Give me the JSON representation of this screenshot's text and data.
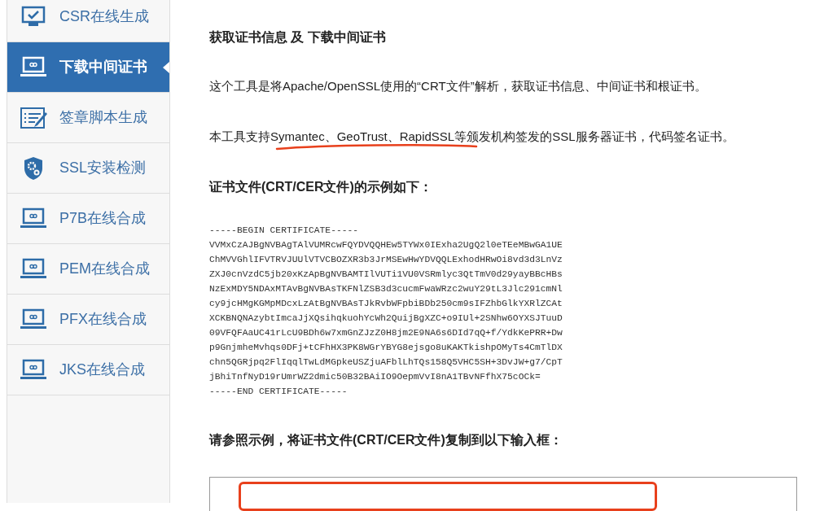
{
  "sidebar": {
    "items": [
      {
        "label": "CSR在线生成",
        "kind": "monitor",
        "selected": false
      },
      {
        "label": "下载中间证书",
        "kind": "laptop",
        "selected": true
      },
      {
        "label": "签章脚本生成",
        "kind": "form",
        "selected": false
      },
      {
        "label": "SSL安装检测",
        "kind": "shield",
        "selected": false
      },
      {
        "label": "P7B在线合成",
        "kind": "laptop",
        "selected": false
      },
      {
        "label": "PEM在线合成",
        "kind": "laptop",
        "selected": false
      },
      {
        "label": "PFX在线合成",
        "kind": "laptop",
        "selected": false
      },
      {
        "label": "JKS在线合成",
        "kind": "laptop",
        "selected": false
      }
    ]
  },
  "content": {
    "title": "获取证书信息 及 下载中间证书",
    "intro": "这个工具是将Apache/OpenSSL使用的“CRT文件”解析，获取证书信息、中间证书和根证书。",
    "support": "本工具支持Symantec、GeoTrust、RapidSSL等颁发机构签发的SSL服务器证书，代码签名证书。",
    "example_heading": "证书文件(CRT/CER文件)的示例如下：",
    "example_lines": [
      "-----BEGIN CERTIFICATE-----",
      "VVMxCzAJBgNVBAgTAlVUMRcwFQYDVQQHEw5TYWx0IExha2UgQ2l0eTEeMBwGA1UE",
      "ChMVVGhlIFVTRVJUUlVTVCBOZXR3b3JrMSEwHwYDVQQLExhodHRwOi8vd3d3LnVz",
      "ZXJ0cnVzdC5jb20xKzApBgNVBAMTIlVUTi1VU0VSRmlyc3QtTmV0d29yayBBcHBs",
      "NzExMDY5NDAxMTAvBgNVBAsTKFNlZSB3d3cucmFwaWRzc2wuY29tL3Jlc291cmNl",
      "cy9jcHMgKGMpMDcxLzAtBgNVBAsTJkRvbWFpbiBDb250cm9sIFZhbGlkYXRlZCAt",
      "XCKBNQNAzybtImcaJjXQsihqkuohYcWh2QuijBgXZC+o9IUl+2SNhw6OYXSJTuuD",
      "09VFQFAaUC41rLcU9BDh6w7xmGnZJzZ0H8jm2E9NA6s6DId7qQ+f/YdkKePRR+Dw",
      "p9GnjmheMvhqs0DFj+tCFhHX3PK8WGrYBYG8ejsgo8uKAKTkishpOMyTs4CmTlDX",
      "chn5QGRjpq2FlIqqlTwLdMGpkeUSZjuAFblLhTQs158Q5VHC5SH+3DvJW+g7/CpT",
      "jBhiTnfNyD19rUmrWZ2dmic50B32BAiIO9OepmVvI8nA1TBvNFfhX75cOCk=",
      "-----END CERTIFICATE-----"
    ],
    "paste_heading": "请参照示例，将证书文件(CRT/CER文件)复制到以下输入框："
  }
}
